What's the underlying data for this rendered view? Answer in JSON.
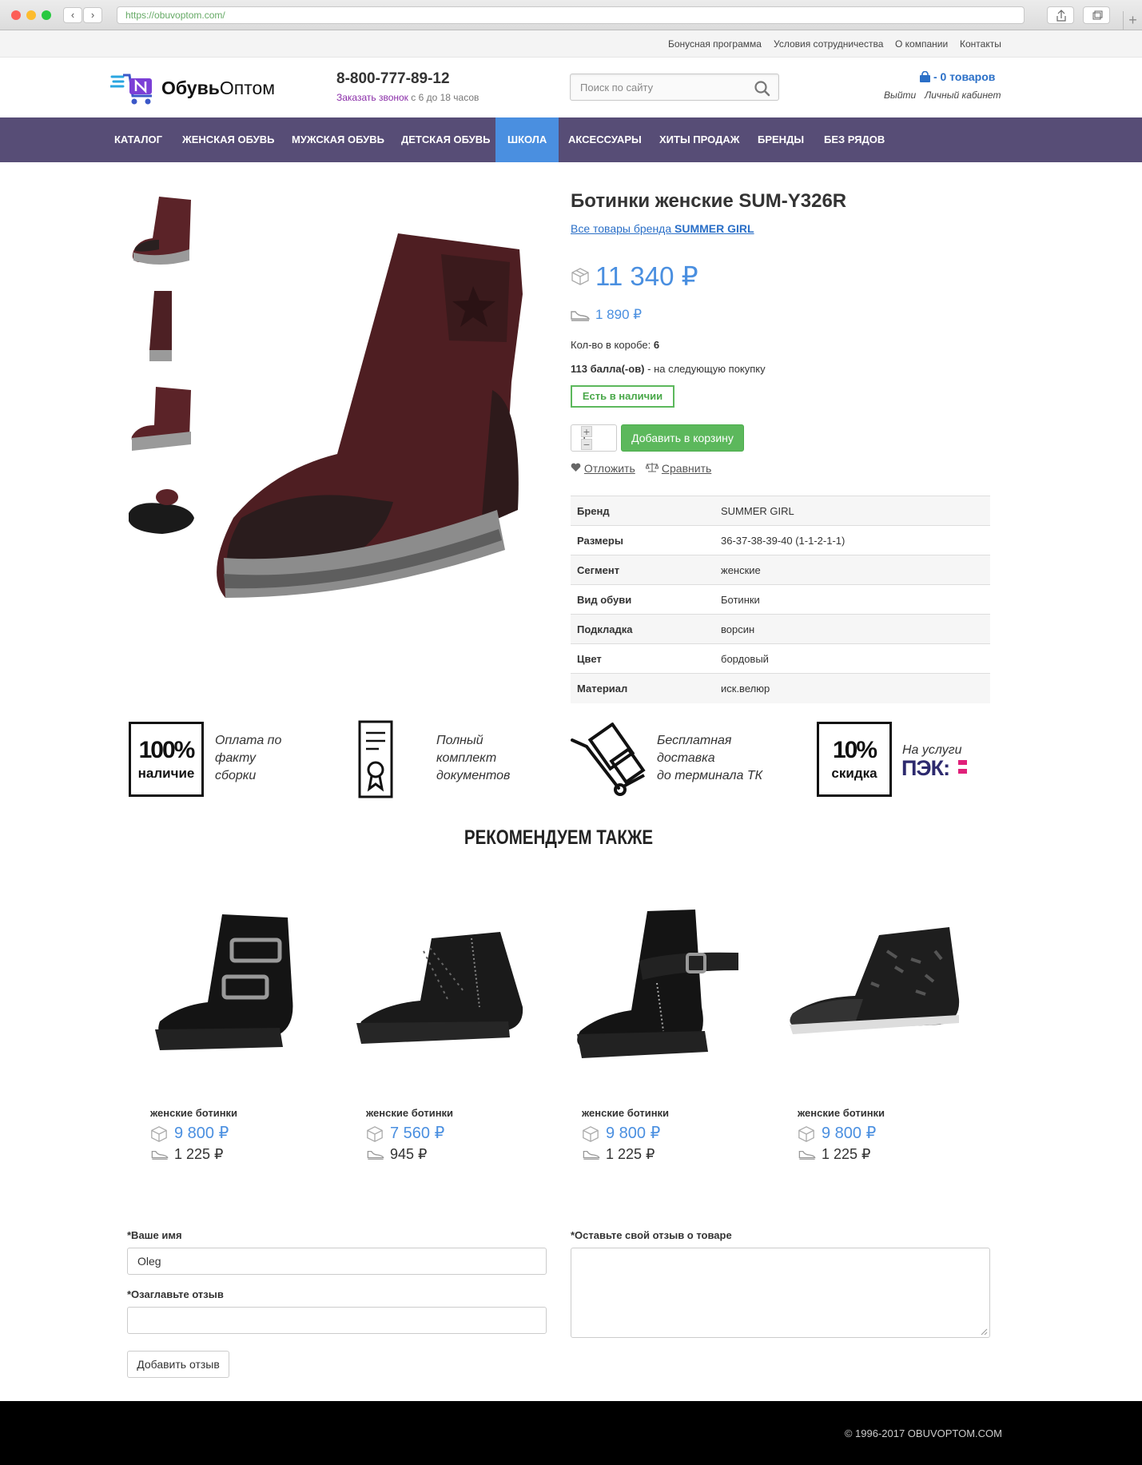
{
  "browser": {
    "url": "https://obuvoptom.com/"
  },
  "toplinks": [
    "Бонусная программа",
    "Условия сотрудничества",
    "О компании",
    "Контакты"
  ],
  "header": {
    "logo_a": "Обувь",
    "logo_b": "Оптом",
    "phone": "8-800-777-89-12",
    "callme_link": "Заказать звонок",
    "callme_hours": " с 6 до 18 часов",
    "search_placeholder": "Поиск по сайту",
    "cart": "- 0 товаров",
    "logout": "Выйти",
    "cabinet": "Личный кабинет"
  },
  "menu": [
    "КАТАЛОГ",
    "ЖЕНСКАЯ ОБУВЬ",
    "МУЖСКАЯ ОБУВЬ",
    "ДЕТСКАЯ ОБУВЬ",
    "ШКОЛА",
    "АКСЕССУАРЫ",
    "ХИТЫ ПРОДАЖ",
    "БРЕНДЫ",
    "БЕЗ РЯДОВ"
  ],
  "menu_active": "ШКОЛА",
  "product": {
    "title": "Ботинки женские SUM-Y326R",
    "brand_prefix": "Все товары бренда ",
    "brand": "SUMMER GIRL",
    "price_box": "11 340 ₽",
    "price_pair": "1 890 ₽",
    "box_qty_label": "Кол-во в коробе: ",
    "box_qty": "6",
    "bonus_bold": "113 балла(-ов)",
    "bonus_rest": " - на следующую покупку",
    "stock": "Есть в наличии",
    "qty": "1",
    "add_to_cart": "Добавить в корзину",
    "defer": "Отложить",
    "compare": "Сравнить",
    "specs": [
      {
        "k": "Бренд",
        "v": "SUMMER GIRL"
      },
      {
        "k": "Размеры",
        "v": "36-37-38-39-40 (1-1-2-1-1)"
      },
      {
        "k": "Сегмент",
        "v": "женские"
      },
      {
        "k": "Вид обуви",
        "v": "Ботинки"
      },
      {
        "k": "Подкладка",
        "v": "ворсин"
      },
      {
        "k": "Цвет",
        "v": "бордовый"
      },
      {
        "k": "Материал",
        "v": "иск.велюр"
      }
    ]
  },
  "features": [
    {
      "box_big": "100%",
      "box_small": "наличие",
      "lines": [
        "Оплата по",
        "факту",
        "сборки"
      ]
    },
    {
      "lines": [
        "Полный",
        "комплект",
        "документов"
      ]
    },
    {
      "lines": [
        "Бесплатная",
        "доставка",
        "до терминала ТК"
      ]
    },
    {
      "box_big": "10%",
      "box_small": "скидка",
      "lines": [
        "На услуги"
      ],
      "logo": "ПЭК:"
    }
  ],
  "recommend_title": "РЕКОМЕНДУЕМ ТАКЖЕ",
  "recommend": [
    {
      "name": "женские ботинки",
      "price_box": "9 800 ₽",
      "price_pair": "1 225 ₽"
    },
    {
      "name": "женские ботинки",
      "price_box": "7 560 ₽",
      "price_pair": "945 ₽"
    },
    {
      "name": "женские ботинки",
      "price_box": "9 800 ₽",
      "price_pair": "1 225 ₽"
    },
    {
      "name": "женские ботинки",
      "price_box": "9 800 ₽",
      "price_pair": "1 225 ₽"
    }
  ],
  "review": {
    "name_label": "*Ваше имя",
    "name_value": "Oleg",
    "title_label": "*Озаглавьте отзыв",
    "title_value": "",
    "text_label": "*Оставьте свой отзыв о товаре",
    "submit": "Добавить отзыв"
  },
  "footer": "© 1996-2017 OBUVOPTOM.COM"
}
